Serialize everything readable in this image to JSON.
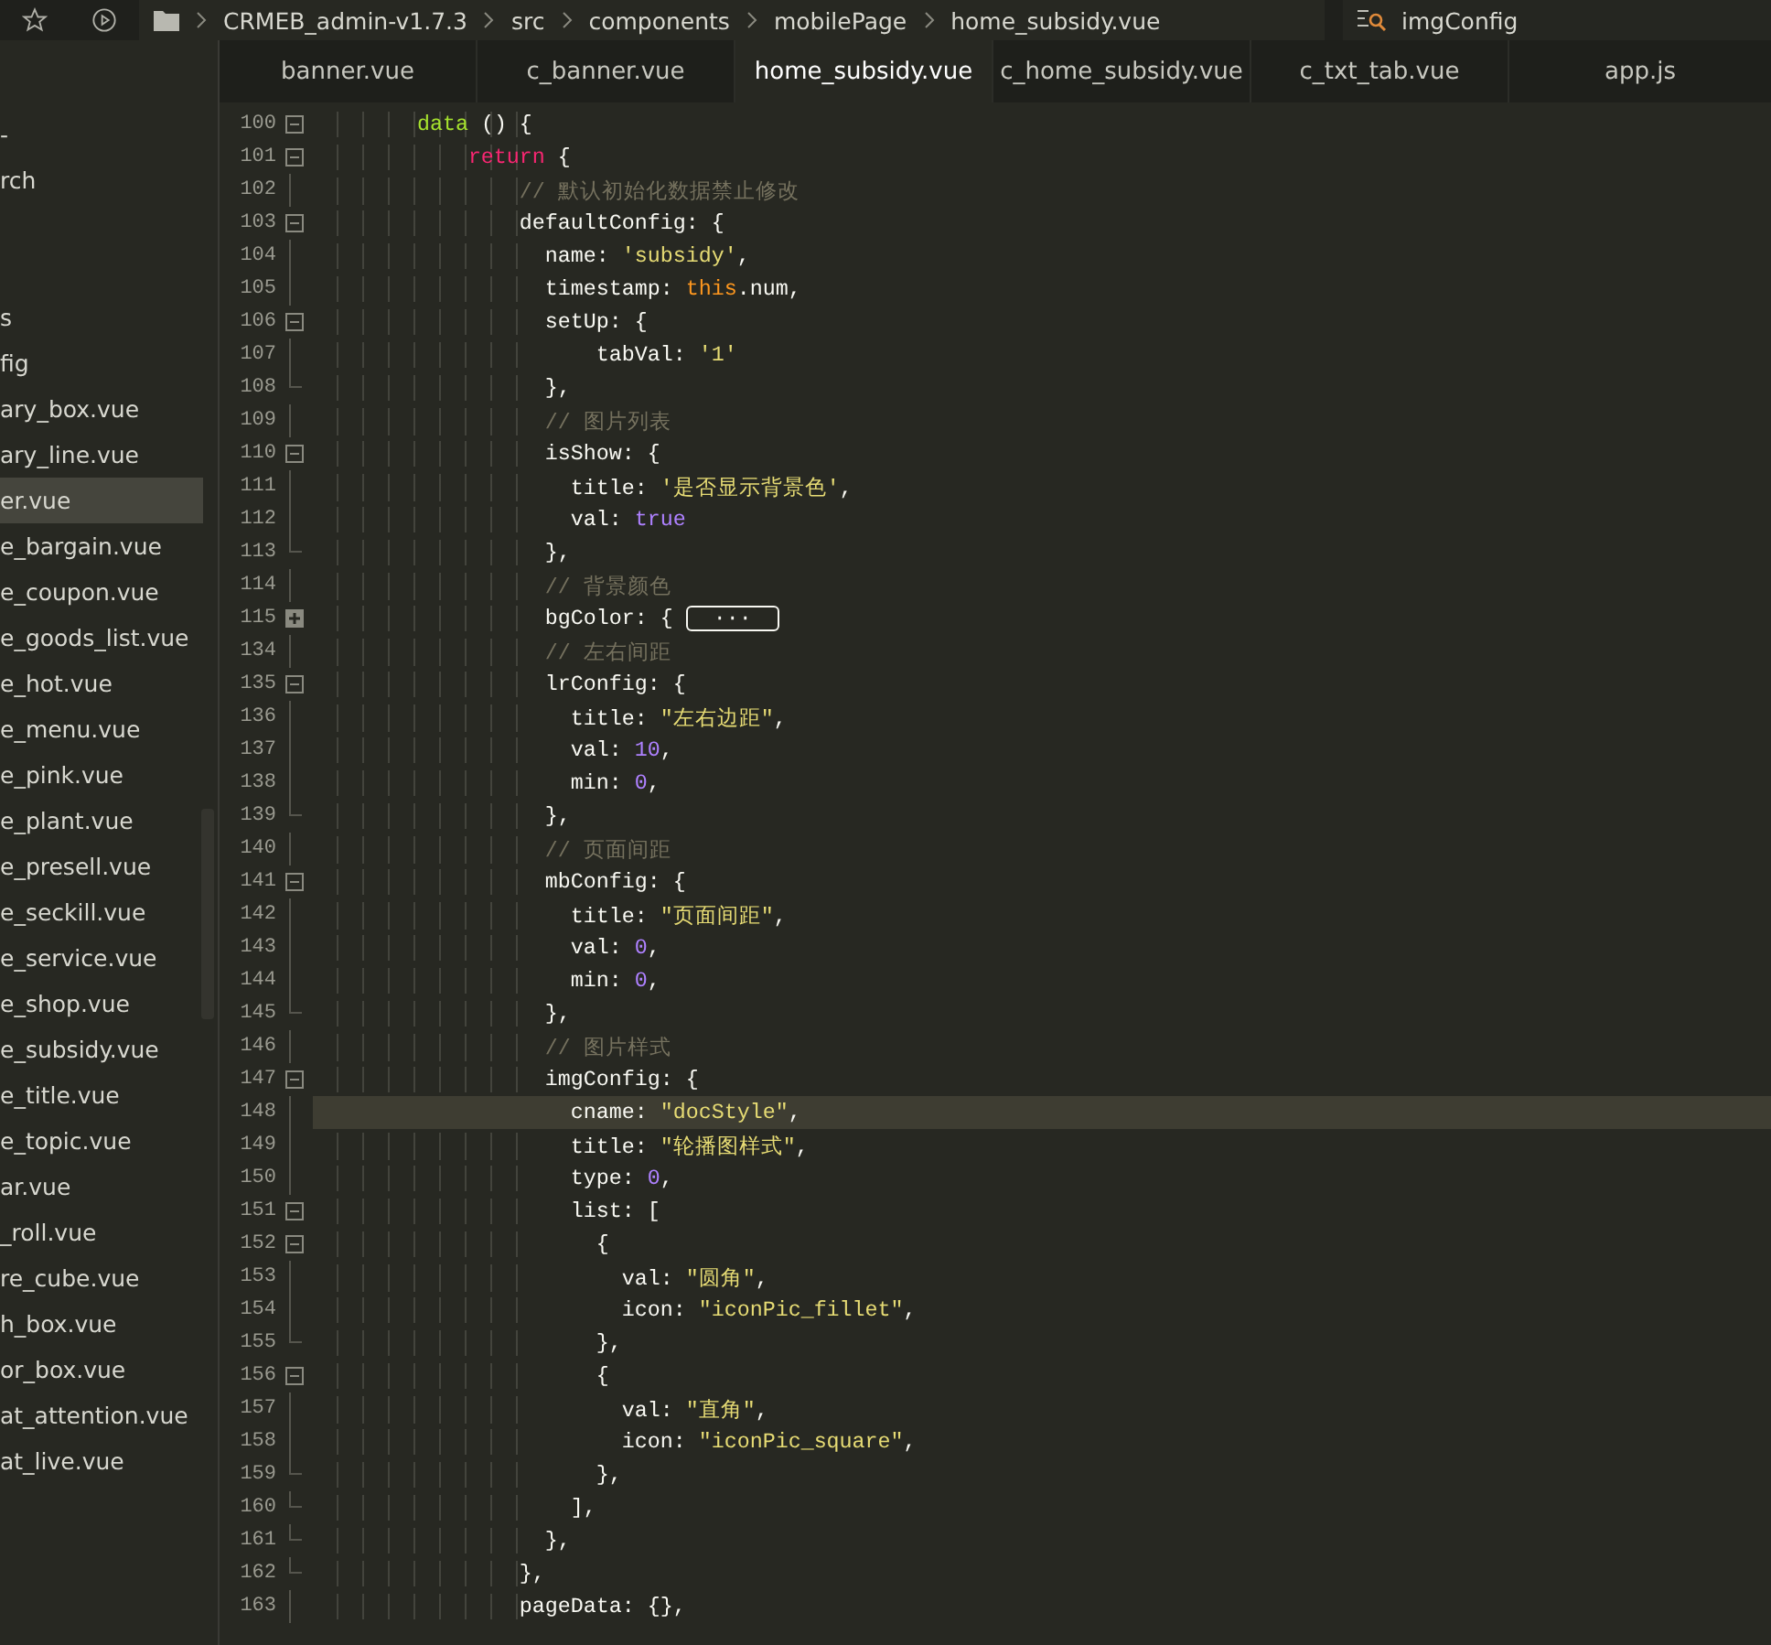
{
  "breadcrumb": [
    "CRMEB_admin-v1.7.3",
    "src",
    "components",
    "mobilePage",
    "home_subsidy.vue"
  ],
  "symbol_search": {
    "value": "imgConfig"
  },
  "sidebar": {
    "items": [
      {
        "kind": "file",
        "label": "-",
        "selected": false
      },
      {
        "kind": "file",
        "label": "rch",
        "selected": false
      },
      {
        "kind": "blank"
      },
      {
        "kind": "blank"
      },
      {
        "kind": "file",
        "label": "s",
        "selected": false
      },
      {
        "kind": "file",
        "label": "fig",
        "selected": false
      },
      {
        "kind": "file",
        "label": "ary_box.vue",
        "selected": false
      },
      {
        "kind": "file",
        "label": "ary_line.vue",
        "selected": false
      },
      {
        "kind": "file",
        "label": "er.vue",
        "selected": true
      },
      {
        "kind": "file",
        "label": "e_bargain.vue",
        "selected": false
      },
      {
        "kind": "file",
        "label": "e_coupon.vue",
        "selected": false
      },
      {
        "kind": "file",
        "label": "e_goods_list.vue",
        "selected": false
      },
      {
        "kind": "file",
        "label": "e_hot.vue",
        "selected": false
      },
      {
        "kind": "file",
        "label": "e_menu.vue",
        "selected": false
      },
      {
        "kind": "file",
        "label": "e_pink.vue",
        "selected": false
      },
      {
        "kind": "file",
        "label": "e_plant.vue",
        "selected": false
      },
      {
        "kind": "file",
        "label": "e_presell.vue",
        "selected": false
      },
      {
        "kind": "file",
        "label": "e_seckill.vue",
        "selected": false
      },
      {
        "kind": "file",
        "label": "e_service.vue",
        "selected": false
      },
      {
        "kind": "file",
        "label": "e_shop.vue",
        "selected": false
      },
      {
        "kind": "file",
        "label": "e_subsidy.vue",
        "selected": false
      },
      {
        "kind": "file",
        "label": "e_title.vue",
        "selected": false
      },
      {
        "kind": "file",
        "label": "e_topic.vue",
        "selected": false
      },
      {
        "kind": "file",
        "label": "ar.vue",
        "selected": false
      },
      {
        "kind": "file",
        "label": "_roll.vue",
        "selected": false
      },
      {
        "kind": "file",
        "label": "re_cube.vue",
        "selected": false
      },
      {
        "kind": "file",
        "label": "h_box.vue",
        "selected": false
      },
      {
        "kind": "file",
        "label": "or_box.vue",
        "selected": false
      },
      {
        "kind": "file",
        "label": "at_attention.vue",
        "selected": false
      },
      {
        "kind": "file",
        "label": "at_live.vue",
        "selected": false
      }
    ]
  },
  "tabs": [
    {
      "label": "banner.vue",
      "selected": false
    },
    {
      "label": "c_banner.vue",
      "selected": false
    },
    {
      "label": "home_subsidy.vue",
      "selected": true
    },
    {
      "label": "c_home_subsidy.vue",
      "selected": false
    },
    {
      "label": "c_txt_tab.vue",
      "selected": false
    },
    {
      "label": "app.js",
      "selected": false
    }
  ],
  "code_lines": [
    {
      "number": "100",
      "kind": "open",
      "current": false,
      "tokens": [
        {
          "text": "        data",
          "kind": "func"
        },
        {
          "text": " () {",
          "kind": "plain"
        }
      ]
    },
    {
      "number": "101",
      "kind": "open",
      "current": false,
      "tokens": [
        {
          "text": "            return",
          "kind": "keyword"
        },
        {
          "text": " {",
          "kind": "plain"
        }
      ]
    },
    {
      "number": "102",
      "kind": "body",
      "current": false,
      "tokens": [
        {
          "text": "                // 默认初始化数据禁止修改",
          "kind": "comment"
        }
      ]
    },
    {
      "number": "103",
      "kind": "open",
      "current": false,
      "tokens": [
        {
          "text": "                defaultConfig: {",
          "kind": "plain"
        }
      ]
    },
    {
      "number": "104",
      "kind": "body",
      "current": false,
      "tokens": [
        {
          "text": "                  name: ",
          "kind": "plain"
        },
        {
          "text": "'subsidy'",
          "kind": "string"
        },
        {
          "text": ",",
          "kind": "plain"
        }
      ]
    },
    {
      "number": "105",
      "kind": "body",
      "current": false,
      "tokens": [
        {
          "text": "                  timestamp: ",
          "kind": "plain"
        },
        {
          "text": "this",
          "kind": "this"
        },
        {
          "text": ".num,",
          "kind": "plain"
        }
      ]
    },
    {
      "number": "106",
      "kind": "open",
      "current": false,
      "tokens": [
        {
          "text": "                  setUp: {",
          "kind": "plain"
        }
      ]
    },
    {
      "number": "107",
      "kind": "body",
      "current": false,
      "tokens": [
        {
          "text": "                      tabVal: ",
          "kind": "plain"
        },
        {
          "text": "'1'",
          "kind": "string"
        }
      ]
    },
    {
      "number": "108",
      "kind": "end",
      "current": false,
      "tokens": [
        {
          "text": "                  },",
          "kind": "plain"
        }
      ]
    },
    {
      "number": "109",
      "kind": "body",
      "current": false,
      "tokens": [
        {
          "text": "                  // 图片列表",
          "kind": "comment"
        }
      ]
    },
    {
      "number": "110",
      "kind": "open",
      "current": false,
      "tokens": [
        {
          "text": "                  isShow: {",
          "kind": "plain"
        }
      ]
    },
    {
      "number": "111",
      "kind": "body",
      "current": false,
      "tokens": [
        {
          "text": "                    title: ",
          "kind": "plain"
        },
        {
          "text": "'是否显示背景色'",
          "kind": "string"
        },
        {
          "text": ",",
          "kind": "plain"
        }
      ]
    },
    {
      "number": "112",
      "kind": "body",
      "current": false,
      "tokens": [
        {
          "text": "                    val: ",
          "kind": "plain"
        },
        {
          "text": "true",
          "kind": "number"
        }
      ]
    },
    {
      "number": "113",
      "kind": "end",
      "current": false,
      "tokens": [
        {
          "text": "                  },",
          "kind": "plain"
        }
      ]
    },
    {
      "number": "114",
      "kind": "body",
      "current": false,
      "tokens": [
        {
          "text": "                  // 背景颜色",
          "kind": "comment"
        }
      ]
    },
    {
      "number": "115",
      "kind": "collapsed",
      "current": false,
      "tokens": [
        {
          "text": "                  bgColor: {",
          "kind": "plain"
        },
        {
          "text": "···",
          "kind": "ellipsis"
        }
      ]
    },
    {
      "number": "134",
      "kind": "body",
      "current": false,
      "tokens": [
        {
          "text": "                  // 左右间距",
          "kind": "comment"
        }
      ]
    },
    {
      "number": "135",
      "kind": "open",
      "current": false,
      "tokens": [
        {
          "text": "                  lrConfig: {",
          "kind": "plain"
        }
      ]
    },
    {
      "number": "136",
      "kind": "body",
      "current": false,
      "tokens": [
        {
          "text": "                    title: ",
          "kind": "plain"
        },
        {
          "text": "\"左右边距\"",
          "kind": "string"
        },
        {
          "text": ",",
          "kind": "plain"
        }
      ]
    },
    {
      "number": "137",
      "kind": "body",
      "current": false,
      "tokens": [
        {
          "text": "                    val: ",
          "kind": "plain"
        },
        {
          "text": "10",
          "kind": "number"
        },
        {
          "text": ",",
          "kind": "plain"
        }
      ]
    },
    {
      "number": "138",
      "kind": "body",
      "current": false,
      "tokens": [
        {
          "text": "                    min: ",
          "kind": "plain"
        },
        {
          "text": "0",
          "kind": "number"
        },
        {
          "text": ",",
          "kind": "plain"
        }
      ]
    },
    {
      "number": "139",
      "kind": "end",
      "current": false,
      "tokens": [
        {
          "text": "                  },",
          "kind": "plain"
        }
      ]
    },
    {
      "number": "140",
      "kind": "body",
      "current": false,
      "tokens": [
        {
          "text": "                  // 页面间距",
          "kind": "comment"
        }
      ]
    },
    {
      "number": "141",
      "kind": "open",
      "current": false,
      "tokens": [
        {
          "text": "                  mbConfig: {",
          "kind": "plain"
        }
      ]
    },
    {
      "number": "142",
      "kind": "body",
      "current": false,
      "tokens": [
        {
          "text": "                    title: ",
          "kind": "plain"
        },
        {
          "text": "\"页面间距\"",
          "kind": "string"
        },
        {
          "text": ",",
          "kind": "plain"
        }
      ]
    },
    {
      "number": "143",
      "kind": "body",
      "current": false,
      "tokens": [
        {
          "text": "                    val: ",
          "kind": "plain"
        },
        {
          "text": "0",
          "kind": "number"
        },
        {
          "text": ",",
          "kind": "plain"
        }
      ]
    },
    {
      "number": "144",
      "kind": "body",
      "current": false,
      "tokens": [
        {
          "text": "                    min: ",
          "kind": "plain"
        },
        {
          "text": "0",
          "kind": "number"
        },
        {
          "text": ",",
          "kind": "plain"
        }
      ]
    },
    {
      "number": "145",
      "kind": "end",
      "current": false,
      "tokens": [
        {
          "text": "                  },",
          "kind": "plain"
        }
      ]
    },
    {
      "number": "146",
      "kind": "body",
      "current": false,
      "tokens": [
        {
          "text": "                  // 图片样式",
          "kind": "comment"
        }
      ]
    },
    {
      "number": "147",
      "kind": "open",
      "current": false,
      "tokens": [
        {
          "text": "                  imgConfig: {",
          "kind": "plain"
        }
      ]
    },
    {
      "number": "148",
      "kind": "body",
      "current": true,
      "tokens": [
        {
          "text": "                    cname: ",
          "kind": "plain"
        },
        {
          "text": "\"docStyle\"",
          "kind": "string"
        },
        {
          "text": ",",
          "kind": "plain"
        }
      ]
    },
    {
      "number": "149",
      "kind": "body",
      "current": false,
      "tokens": [
        {
          "text": "                    title: ",
          "kind": "plain"
        },
        {
          "text": "\"轮播图样式\"",
          "kind": "string"
        },
        {
          "text": ",",
          "kind": "plain"
        }
      ]
    },
    {
      "number": "150",
      "kind": "body",
      "current": false,
      "tokens": [
        {
          "text": "                    type: ",
          "kind": "plain"
        },
        {
          "text": "0",
          "kind": "number"
        },
        {
          "text": ",",
          "kind": "plain"
        }
      ]
    },
    {
      "number": "151",
      "kind": "open",
      "current": false,
      "tokens": [
        {
          "text": "                    list: [",
          "kind": "plain"
        }
      ]
    },
    {
      "number": "152",
      "kind": "open",
      "current": false,
      "tokens": [
        {
          "text": "                      {",
          "kind": "plain"
        }
      ]
    },
    {
      "number": "153",
      "kind": "body",
      "current": false,
      "tokens": [
        {
          "text": "                        val: ",
          "kind": "plain"
        },
        {
          "text": "\"圆角\"",
          "kind": "string"
        },
        {
          "text": ",",
          "kind": "plain"
        }
      ]
    },
    {
      "number": "154",
      "kind": "body",
      "current": false,
      "tokens": [
        {
          "text": "                        icon: ",
          "kind": "plain"
        },
        {
          "text": "\"iconPic_fillet\"",
          "kind": "string"
        },
        {
          "text": ",",
          "kind": "plain"
        }
      ]
    },
    {
      "number": "155",
      "kind": "end",
      "current": false,
      "tokens": [
        {
          "text": "                      },",
          "kind": "plain"
        }
      ]
    },
    {
      "number": "156",
      "kind": "open",
      "current": false,
      "tokens": [
        {
          "text": "                      {",
          "kind": "plain"
        }
      ]
    },
    {
      "number": "157",
      "kind": "body",
      "current": false,
      "tokens": [
        {
          "text": "                        val: ",
          "kind": "plain"
        },
        {
          "text": "\"直角\"",
          "kind": "string"
        },
        {
          "text": ",",
          "kind": "plain"
        }
      ]
    },
    {
      "number": "158",
      "kind": "body",
      "current": false,
      "tokens": [
        {
          "text": "                        icon: ",
          "kind": "plain"
        },
        {
          "text": "\"iconPic_square\"",
          "kind": "string"
        },
        {
          "text": ",",
          "kind": "plain"
        }
      ]
    },
    {
      "number": "159",
      "kind": "end",
      "current": false,
      "tokens": [
        {
          "text": "                      },",
          "kind": "plain"
        }
      ]
    },
    {
      "number": "160",
      "kind": "end",
      "current": false,
      "tokens": [
        {
          "text": "                    ],",
          "kind": "plain"
        }
      ]
    },
    {
      "number": "161",
      "kind": "end",
      "current": false,
      "tokens": [
        {
          "text": "                  },",
          "kind": "plain"
        }
      ]
    },
    {
      "number": "162",
      "kind": "end",
      "current": false,
      "tokens": [
        {
          "text": "                },",
          "kind": "plain"
        }
      ]
    },
    {
      "number": "163",
      "kind": "body",
      "current": false,
      "tokens": [
        {
          "text": "                pageData: {},",
          "kind": "plain"
        }
      ]
    }
  ]
}
